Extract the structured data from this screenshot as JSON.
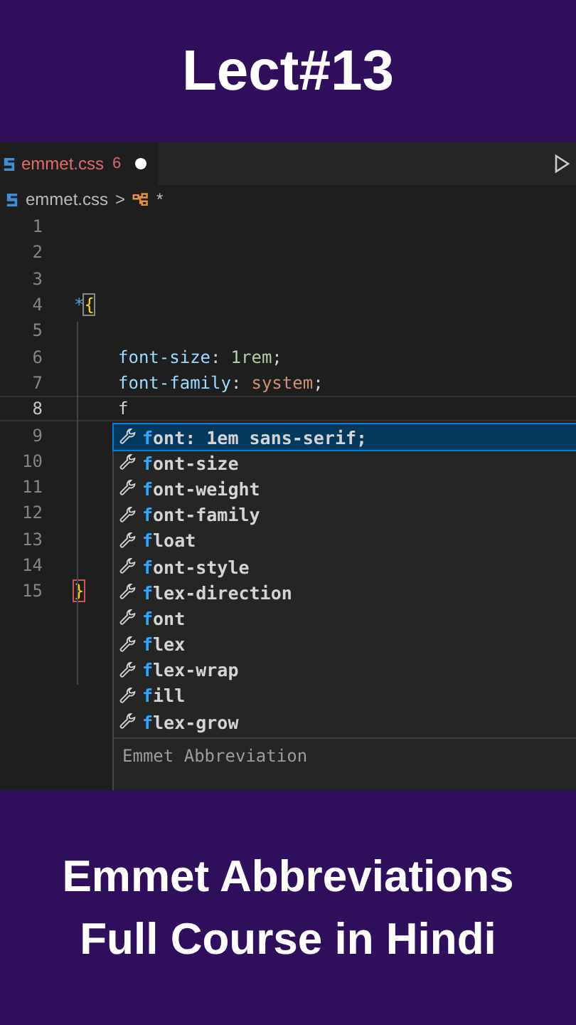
{
  "header": {
    "title": "Lect#13"
  },
  "editor": {
    "tab": {
      "filename": "emmet.css",
      "problems": "6",
      "modified": true,
      "selected": true
    },
    "breadcrumb": {
      "file": "emmet.css",
      "separator": ">",
      "symbol": "*"
    },
    "lines": [
      {
        "number": "1",
        "kind": "blank",
        "current": false
      },
      {
        "number": "2",
        "kind": "blank",
        "current": false
      },
      {
        "number": "3",
        "kind": "blank",
        "current": false
      },
      {
        "number": "4",
        "kind": "open",
        "selector": "*",
        "brace": "{",
        "current": false
      },
      {
        "number": "5",
        "kind": "blank",
        "current": false
      },
      {
        "number": "6",
        "kind": "declaration",
        "property": "font-size",
        "colon": ":",
        "value": "1rem",
        "semicolon": ";",
        "current": false
      },
      {
        "number": "7",
        "kind": "declaration",
        "property": "font-family",
        "colon": ":",
        "value": "system",
        "semicolon": ";",
        "current": false
      },
      {
        "number": "8",
        "kind": "typing",
        "text": "f",
        "current": true
      },
      {
        "number": "9",
        "kind": "blank",
        "current": false
      },
      {
        "number": "10",
        "kind": "blank",
        "current": false
      },
      {
        "number": "11",
        "kind": "blank",
        "current": false
      },
      {
        "number": "12",
        "kind": "blank",
        "current": false
      },
      {
        "number": "13",
        "kind": "blank",
        "current": false
      },
      {
        "number": "14",
        "kind": "blank",
        "current": false
      },
      {
        "number": "15",
        "kind": "close",
        "brace": "}",
        "current": false
      }
    ],
    "suggestions": {
      "items": [
        {
          "label": "font: 1em sans-serif;",
          "selected": true
        },
        {
          "label": "font-size",
          "selected": false
        },
        {
          "label": "font-weight",
          "selected": false
        },
        {
          "label": "font-family",
          "selected": false
        },
        {
          "label": "float",
          "selected": false
        },
        {
          "label": "font-style",
          "selected": false
        },
        {
          "label": "flex-direction",
          "selected": false
        },
        {
          "label": "font",
          "selected": false
        },
        {
          "label": "flex",
          "selected": false
        },
        {
          "label": "flex-wrap",
          "selected": false
        },
        {
          "label": "fill",
          "selected": false
        },
        {
          "label": "flex-grow",
          "selected": false
        }
      ],
      "detail": "Emmet Abbreviation"
    }
  },
  "footer": {
    "lines": [
      "Emmet Abbreviations",
      "Full Course in Hindi"
    ]
  }
}
